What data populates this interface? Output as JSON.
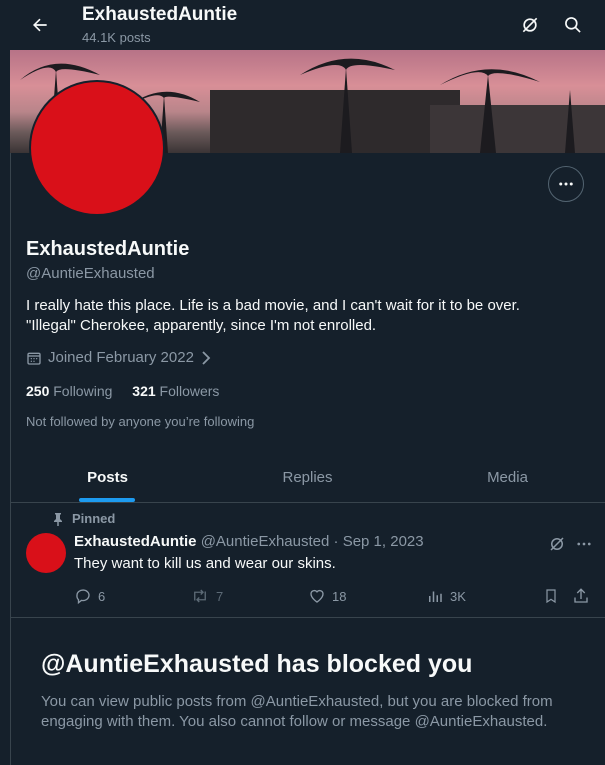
{
  "header": {
    "display_name": "ExhaustedAuntie",
    "posts_count": "44.1K posts",
    "back_icon": "arrow-left-icon",
    "grok_icon": "grok-icon",
    "search_icon": "search-icon"
  },
  "profile": {
    "display_name": "ExhaustedAuntie",
    "handle": "@AuntieExhausted",
    "bio_line1": "I really hate this place.  Life is a bad movie, and I can't wait for it to be over.",
    "bio_line2": "\"Illegal\" Cherokee, apparently, since I'm not enrolled.",
    "joined": "Joined February 2022",
    "following_count": "250",
    "following_label": "Following",
    "followers_count": "321",
    "followers_label": "Followers",
    "not_followed": "Not followed by anyone you’re following",
    "avatar_color": "#d91019"
  },
  "tabs": [
    {
      "label": "Posts",
      "active": true
    },
    {
      "label": "Replies",
      "active": false
    },
    {
      "label": "Media",
      "active": false
    }
  ],
  "pinned_post": {
    "pinned_label": "Pinned",
    "author_name": "ExhaustedAuntie",
    "author_handle": "@AuntieExhausted",
    "separator": " · ",
    "date": "Sep 1, 2023",
    "text": "They want to kill us and wear our skins.",
    "replies": "6",
    "reposts": "7",
    "likes": "18",
    "views": "3K"
  },
  "blocked": {
    "title": "@AuntieExhausted has blocked you",
    "body": "You can view public posts from @AuntieExhausted, but you are blocked from engaging with them. You also cannot follow or message @AuntieExhausted."
  },
  "colors": {
    "background": "#15202b",
    "accent": "#1d9bf0",
    "muted_text": "#8b98a5",
    "border": "#38444d"
  }
}
